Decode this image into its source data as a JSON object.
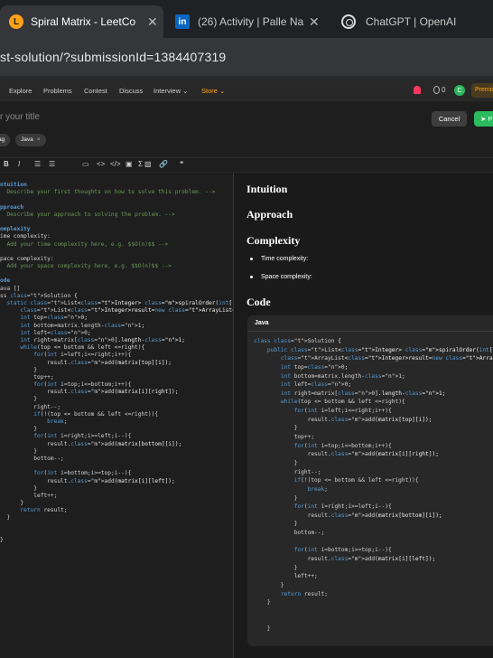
{
  "browser": {
    "tabs": [
      {
        "title": "Spiral Matrix - LeetCo",
        "active": true
      },
      {
        "title": "(26) Activity | Palle Na",
        "active": false
      },
      {
        "title": "ChatGPT | OpenAI",
        "active": false
      }
    ],
    "url": "st-solution/?submissionId=1384407319"
  },
  "nav": {
    "items": [
      "Explore",
      "Problems",
      "Contest",
      "Discuss",
      "Interview",
      "Store"
    ],
    "streak": "0",
    "avatar_letter": "C",
    "premium": "Premiu"
  },
  "editor": {
    "title_placeholder": "r your title",
    "cancel": "Cancel",
    "post": "P",
    "tags": [
      "ag",
      "Java"
    ],
    "tag_remove": "×"
  },
  "toolbar": {
    "items": [
      "B",
      "I",
      "☰",
      "☰",
      "▭",
      "<>",
      "</>",
      "▣",
      "Σ",
      "▧",
      "🔗",
      "❝"
    ]
  },
  "markdown_lines": [
    "ntuition",
    "  Describe your first thoughts on how to solve this problem. -->",
    "",
    "pproach",
    "  Describe your approach to solving the problem. -->",
    "",
    "omplexity",
    "ime complexity:",
    "  Add your time complexity here, e.g. $$O(n)$$ -->",
    "",
    "pace complexity:",
    "  Add your space complexity here, e.g. $$O(n)$$ -->",
    "",
    "ode",
    "ava []",
    "ss Solution {",
    "  static List<Integer> spiralOrder(int[][] matrix) {",
    "      List<Integer>result=new ArrayList<Integer>();",
    "      int top=0;",
    "      int bottom=matrix.length-1;",
    "      int left=0;",
    "      int right=matrix[0].length-1;",
    "      while(top <= bottom && left <=right){",
    "          for(int i=left;i<=right;i++){",
    "              result.add(matrix[top][i]);",
    "          }",
    "          top++;",
    "          for(int i=top;i<=bottom;i++){",
    "              result.add(matrix[i][right]);",
    "          }",
    "          right--;",
    "          if(!(top <= bottom && left <=right)){",
    "              break;",
    "          }",
    "          for(int i=right;i>=left;i--){",
    "              result.add(matrix[bottom][i]);",
    "          }",
    "          bottom--;",
    "",
    "          for(int i=bottom;i>=top;i--){",
    "              result.add(matrix[i][left]);",
    "          }",
    "          left++;",
    "      }",
    "      return result;",
    "  }",
    "",
    "",
    "}"
  ],
  "preview": {
    "intuition": "Intuition",
    "approach": "Approach",
    "complexity": "Complexity",
    "bullets": [
      "Time complexity:",
      "Space complexity:"
    ],
    "code": "Code",
    "lang": "Java",
    "code_lines": [
      "class Solution {",
      "    public List<Integer> spiralOrder(int[][] matrix) {",
      "        ArrayList<Integer>result=new ArrayList<Integer>();",
      "        int top=0;",
      "        int bottom=matrix.length-1;",
      "        int left=0;",
      "        int right=matrix[0].length-1;",
      "        while(top <= bottom && left <=right){",
      "            for(int i=left;i<=right;i++){",
      "                result.add(matrix[top][i]);",
      "            }",
      "            top++;",
      "            for(int i=top;i<=bottom;i++){",
      "                result.add(matrix[i][right]);",
      "            }",
      "            right--;",
      "            if(!(top <= bottom && left <=right)){",
      "                break;",
      "            }",
      "            for(int i=right;i>=left;i--){",
      "                result.add(matrix[bottom][i]);",
      "            }",
      "            bottom--;",
      "",
      "            for(int i=bottom;i>=top;i--){",
      "                result.add(matrix[i][left]);",
      "            }",
      "            left++;",
      "        }",
      "        return result;",
      "    }",
      "",
      "",
      "    }"
    ]
  },
  "colors": {
    "brand": "#ffa116",
    "accept": "#2cbb5d",
    "keyword": "#569cd6",
    "type": "#4ec9b0",
    "comment": "#6a9955"
  }
}
